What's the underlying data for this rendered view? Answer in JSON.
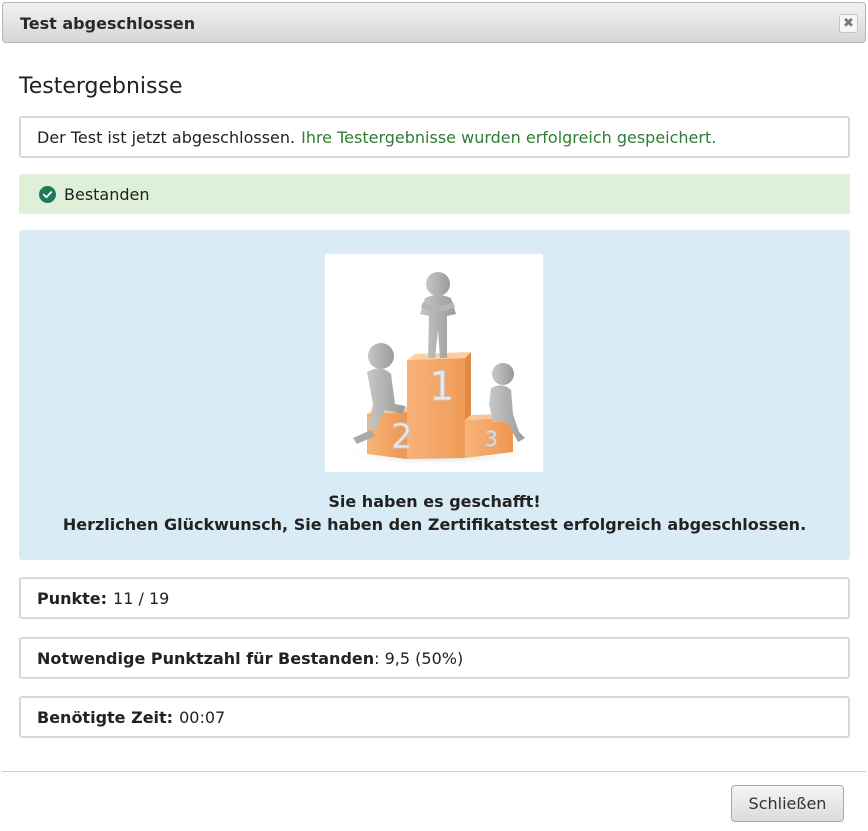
{
  "dialog": {
    "title": "Test abgeschlossen",
    "close_icon_glyph": "✖"
  },
  "heading": "Testergebnisse",
  "message": {
    "text": "Der Test ist jetzt abgeschlossen.",
    "success_text": "Ihre Testergebnisse wurden erfolgreich gespeichert."
  },
  "status": {
    "label": "Bestanden",
    "icon": "check-circle-icon",
    "color": "#1f7a5a"
  },
  "congrats": {
    "line1": "Sie haben es geschafft!",
    "line2": "Herzlichen Glückwunsch, Sie haben den Zertifikatstest erfolgreich abgeschlossen."
  },
  "stats": [
    {
      "label": "Punkte:",
      "value": "11 / 19"
    },
    {
      "label": "Notwendige Punktzahl für Bestanden",
      "value": ": 9,5 (50%)"
    },
    {
      "label": "Benötigte Zeit:",
      "value": "00:07"
    }
  ],
  "footer": {
    "close_button_label": "Schließen"
  },
  "colors": {
    "passed_bg": "#dff0d8",
    "congrats_bg": "#d9ecf6",
    "success_text": "#2e7d32",
    "podium": "#f4a262"
  }
}
